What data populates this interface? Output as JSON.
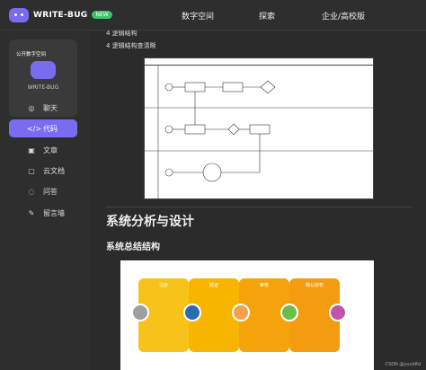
{
  "header": {
    "brand": "WRITE-BUG",
    "badge": "NEW",
    "nav": [
      "数字空间",
      "探索",
      "企业/高校版"
    ]
  },
  "sidebar": {
    "promo_title": "公开数字空间",
    "promo_brand": "WRITE-BUG",
    "items": [
      {
        "label": "聊天",
        "icon": "chat-icon"
      },
      {
        "label": "代码",
        "icon": "code-icon"
      },
      {
        "label": "文章",
        "icon": "article-icon"
      },
      {
        "label": "云文档",
        "icon": "cloud-doc-icon"
      },
      {
        "label": "问答",
        "icon": "qa-icon"
      },
      {
        "label": "留言墙",
        "icon": "message-wall-icon"
      }
    ]
  },
  "main": {
    "line_top": "4 逻辑结构",
    "line_diagram": "4 逻辑结构查清晰",
    "section_title": "系统分析与设计",
    "subsection_title": "系统总结结构",
    "flow_stages": [
      "注册",
      "验证",
      "审核",
      "确认授权"
    ],
    "watermark": "CSDN @yuxb8d"
  },
  "colors": {
    "accent": "#7a6cf0",
    "stage": "#f7b500",
    "stage_dark": "#f39c12"
  }
}
